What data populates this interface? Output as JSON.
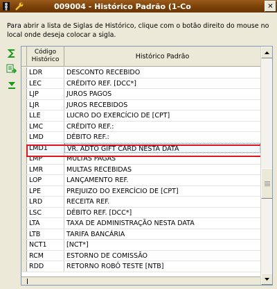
{
  "window": {
    "title": "009004 - Histórico Padrão (1-Co",
    "close_label": "✕"
  },
  "icons": [
    "app-icon",
    "wrench-icon",
    "sigma-icon",
    "export-icon",
    "arrow-down-icon"
  ],
  "instructions": "Para abrir a lista de Siglas de Histórico, clique com o botão direito do mouse no local onde deseja colocar a sigla.",
  "grid": {
    "columns": [
      "Código Histórico",
      "Histórico Padrão"
    ],
    "rows": [
      {
        "code": "LDR",
        "desc": "DESCONTO RECEBIDO"
      },
      {
        "code": "LEC",
        "desc": "CRÉDITO REF. [DCC*]"
      },
      {
        "code": "LJP",
        "desc": "JUROS PAGOS"
      },
      {
        "code": "LJR",
        "desc": "JUROS RECEBIDOS"
      },
      {
        "code": "LLE",
        "desc": "LUCRO DO EXERCÍCIO DE [CPT]"
      },
      {
        "code": "LMC",
        "desc": "CRÉDITO REF.:"
      },
      {
        "code": "LMD",
        "desc": "DÉBITO REF.:"
      },
      {
        "code": "LMD1",
        "desc": "VR. ADTO GIFT CARD NESTA DATA"
      },
      {
        "code": "LMP",
        "desc": "MULTAS PAGAS"
      },
      {
        "code": "LMR",
        "desc": "MULTAS RECEBIDAS"
      },
      {
        "code": "LOP",
        "desc": "LANÇAMENTO REF."
      },
      {
        "code": "LPE",
        "desc": "PREJUIZO DO EXERCÍCIO DE [CPT]"
      },
      {
        "code": "LRD",
        "desc": "RECEITA REF."
      },
      {
        "code": "LSC",
        "desc": "DÉBITO REF. [DCC*]"
      },
      {
        "code": "LTA",
        "desc": "TAXA DE ADMINISTRAÇÃO NESTA DATA"
      },
      {
        "code": "LTB",
        "desc": "TARIFA BANCÁRIA"
      },
      {
        "code": "NCT1",
        "desc": "[NCT*]"
      },
      {
        "code": "RCM",
        "desc": "ESTORNO DE COMISSÃO"
      },
      {
        "code": "RDD",
        "desc": "RETORNO ROBÔ TESTE [NTB]"
      }
    ],
    "selected_index": 7
  },
  "colors": {
    "title_bar": "#7a4108",
    "highlight": "#e0141e",
    "background": "#ece9d8"
  }
}
